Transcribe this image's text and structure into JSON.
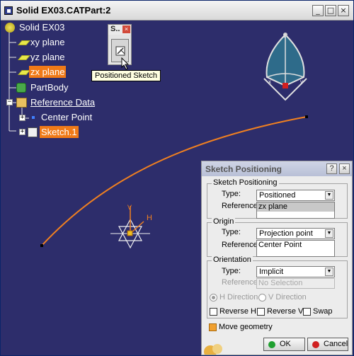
{
  "window": {
    "title": "Solid EX03.CATPart:2",
    "minimize": "_",
    "maximize": "□",
    "close": "×"
  },
  "tree": {
    "root": "Solid EX03",
    "xy_plane": "xy plane",
    "yz_plane": "yz plane",
    "zx_plane": "zx plane",
    "part_body": "PartBody",
    "reference_data": "Reference Data",
    "center_point": "Center Point",
    "sketch": "Sketch.1"
  },
  "mini_toolbar": {
    "title": "S..",
    "close": "×"
  },
  "tooltip": "Positioned Sketch",
  "compass": {
    "label_z": "z",
    "label_x": "x",
    "label_y": "y"
  },
  "sketch_axis": {
    "label_v": "V",
    "label_h": "H"
  },
  "dialog": {
    "title": "Sketch Positioning",
    "help": "?",
    "close": "×",
    "positioning": {
      "title": "Sketch Positioning",
      "type_label": "Type:",
      "type_value": "Positioned",
      "reference_label": "Reference:",
      "reference_value": "zx plane"
    },
    "origin": {
      "title": "Origin",
      "type_label": "Type:",
      "type_value": "Projection point",
      "reference_label": "Reference:",
      "reference_value": "Center Point"
    },
    "orientation": {
      "title": "Orientation",
      "type_label": "Type:",
      "type_value": "Implicit",
      "reference_label": "Reference:",
      "reference_value": "No Selection",
      "h_direction": "H Direction",
      "v_direction": "V Direction",
      "reverse_h": "Reverse H",
      "reverse_v": "Reverse V",
      "swap": "Swap"
    },
    "move_geometry": "Move geometry",
    "ok": "OK",
    "cancel": "Cancel"
  },
  "colors": {
    "viewport": "#2d2d6b",
    "selection": "#f07a18",
    "curve": "#f08020",
    "compass": "#2e6b8a"
  }
}
